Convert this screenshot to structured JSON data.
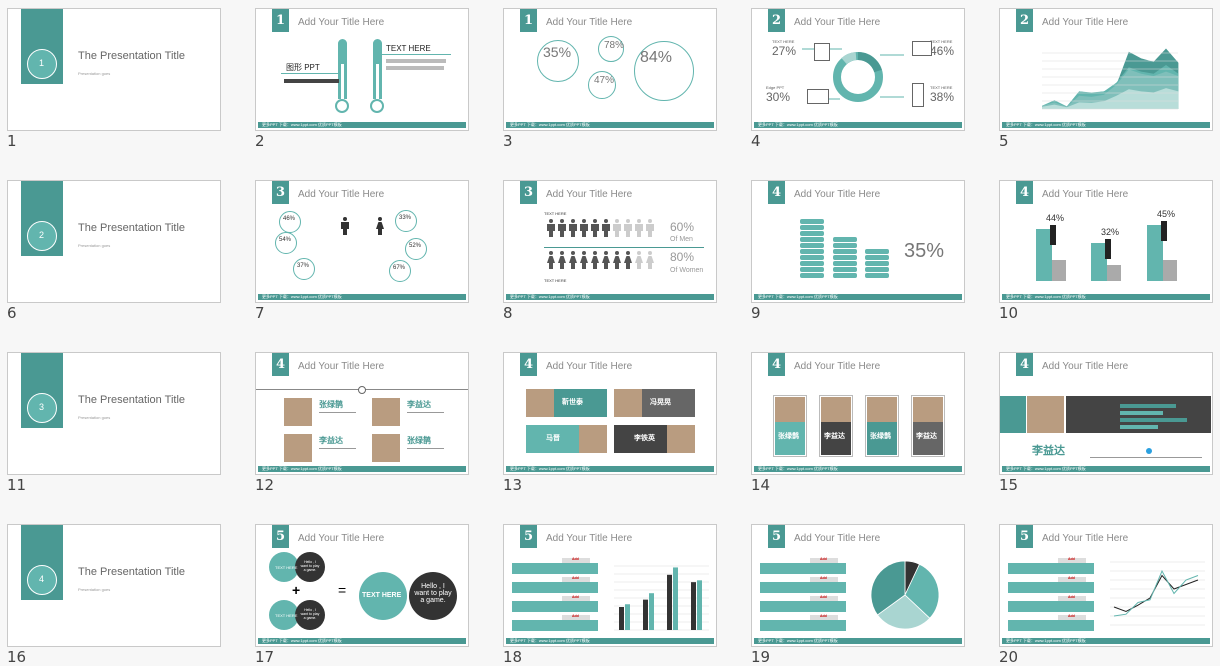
{
  "colors": {
    "teal": "#4a9993",
    "teal_light": "#62b5ae",
    "teal_pale": "#a9d5d1",
    "dark": "#333333",
    "gray": "#666666"
  },
  "footer_text": "更多PPT 下载：www.1ppt.com  优质PPT模板",
  "header_title": "Add Your Title Here",
  "slides": [
    {
      "number": "1",
      "type": "title",
      "section": "1",
      "title": "The Presentation Title",
      "subtitle": "Presentation goes"
    },
    {
      "number": "2",
      "type": "thermo",
      "section": "1",
      "texts": [
        "图形 PPT",
        "TEXT HERE"
      ]
    },
    {
      "number": "3",
      "type": "bubbles",
      "section": "1",
      "values": [
        "35%",
        "78%",
        "47%",
        "84%"
      ]
    },
    {
      "number": "4",
      "type": "donut",
      "section": "2",
      "items": [
        {
          "label": "TEXT HERE",
          "value": "27%"
        },
        {
          "label": "TEXT HERE",
          "value": "46%"
        },
        {
          "label": "Edge PPT",
          "value": "30%"
        },
        {
          "label": "TEXT HERE",
          "value": "38%"
        }
      ]
    },
    {
      "number": "5",
      "type": "area",
      "section": "2"
    },
    {
      "number": "6",
      "type": "title",
      "section": "2",
      "title": "The Presentation Title",
      "subtitle": "Presentation goes"
    },
    {
      "number": "7",
      "type": "people",
      "section": "3",
      "values": [
        "46%",
        "54%",
        "37%",
        "33%",
        "52%",
        "67%"
      ]
    },
    {
      "number": "8",
      "type": "icons",
      "section": "3",
      "label": "TEXT HERE",
      "men": "60%",
      "men_label": "Of Men",
      "women": "80%",
      "women_label": "Of Women"
    },
    {
      "number": "9",
      "type": "stack",
      "section": "4",
      "value": "35%"
    },
    {
      "number": "10",
      "type": "bars10",
      "section": "4",
      "values": [
        "44%",
        "32%",
        "45%"
      ]
    },
    {
      "number": "11",
      "type": "title",
      "section": "3",
      "title": "The Presentation Title",
      "subtitle": "Presentation goes"
    },
    {
      "number": "12",
      "type": "team4",
      "section": "4",
      "names": [
        "张绿鹊",
        "李益达",
        "李益达",
        "张绿鹊"
      ]
    },
    {
      "number": "13",
      "type": "team13",
      "section": "4",
      "names": [
        "靳世泰",
        "冯晃晃",
        "马晋",
        "李铁英"
      ]
    },
    {
      "number": "14",
      "type": "team14",
      "section": "4",
      "names": [
        "张绿鹊",
        "李益达",
        "张绿鹊",
        "李益达"
      ]
    },
    {
      "number": "15",
      "type": "profile",
      "section": "4",
      "name": "李益达"
    },
    {
      "number": "16",
      "type": "title",
      "section": "4",
      "title": "The Presentation Title",
      "subtitle": "Presentation goes"
    },
    {
      "number": "17",
      "type": "equation",
      "section": "5",
      "small_left": "TEXT HERE",
      "small_right": "Hello , I want to play a game.",
      "big_left": "TEXT HERE",
      "big_right": "Hello , I want to play a game.",
      "plus": "+",
      "equals": "="
    },
    {
      "number": "18",
      "type": "barchart",
      "section": "5",
      "tag": "Add"
    },
    {
      "number": "19",
      "type": "pie",
      "section": "5",
      "tag": "Add"
    },
    {
      "number": "20",
      "type": "line",
      "section": "5",
      "tag": "Add"
    }
  ],
  "chart_data": [
    {
      "slide": "5",
      "type": "area",
      "categories": [
        "Jan",
        "Feb",
        "Mar",
        "Apr",
        "May",
        "Jun",
        "Jul",
        "Aug",
        "Sep",
        "Oct",
        "Nov",
        "Dec"
      ],
      "series": [
        {
          "values": [
            10,
            20,
            8,
            30,
            28,
            35,
            60,
            90,
            80,
            75,
            95,
            80
          ]
        },
        {
          "values": [
            15,
            30,
            10,
            60,
            55,
            65,
            110,
            180,
            160,
            150,
            170,
            150
          ]
        },
        {
          "values": [
            15,
            40,
            12,
            80,
            75,
            80,
            120,
            190,
            170,
            160,
            200,
            160
          ]
        },
        {
          "values": [
            10,
            40,
            10,
            80,
            72,
            80,
            110,
            260,
            230,
            215,
            275,
            210
          ]
        }
      ]
    },
    {
      "slide": "18",
      "type": "bar",
      "categories": [
        "Add",
        "Add",
        "Add",
        "Add"
      ],
      "series": [
        {
          "values": [
            25,
            33,
            60,
            52
          ]
        },
        {
          "values": [
            28,
            40,
            68,
            54
          ]
        }
      ],
      "ylim": [
        0,
        75
      ]
    },
    {
      "slide": "19",
      "type": "pie",
      "values": [
        7,
        30,
        28,
        35
      ]
    },
    {
      "slide": "20",
      "type": "line",
      "series": [
        {
          "values": [
            20,
            15,
            22,
            30,
            55,
            40,
            45,
            50
          ]
        },
        {
          "values": [
            10,
            12,
            25,
            28,
            60,
            35,
            50,
            55
          ]
        }
      ],
      "ylim": [
        0,
        70
      ]
    }
  ]
}
